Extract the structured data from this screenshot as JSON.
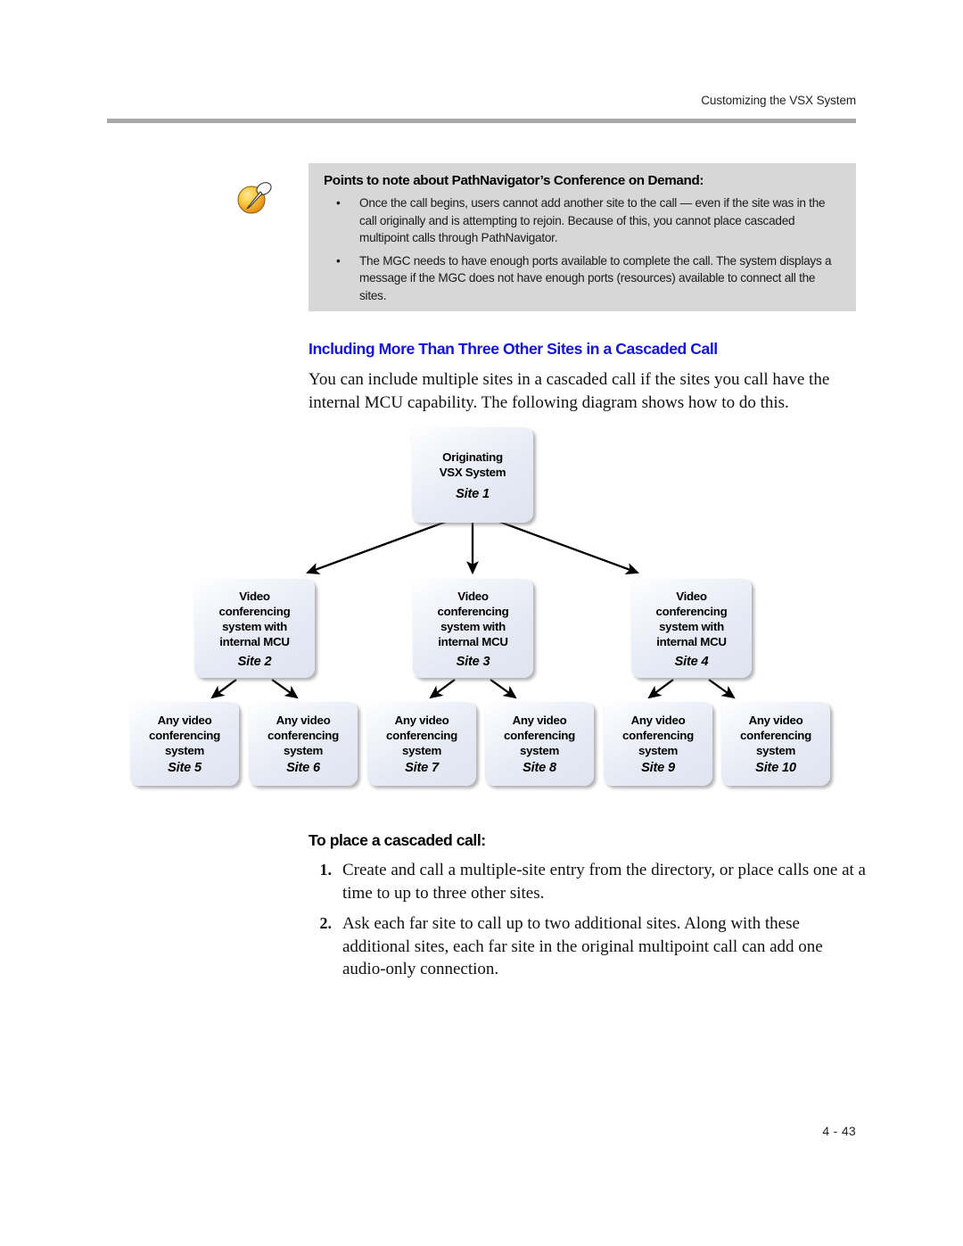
{
  "header": {
    "running_head": "Customizing the VSX System"
  },
  "note": {
    "icon": "note-pushpin-icon",
    "title": "Points to note about PathNavigator’s Conference on Demand:",
    "bullet_marker": "•",
    "bullets": [
      "Once the call begins, users cannot add another site to the call — even if the site was in the call originally and is attempting to rejoin. Because of this, you cannot place cascaded multipoint calls through PathNavigator.",
      "The MGC needs to have enough ports available to complete the call. The system displays a message if the MGC does not have enough ports (resources) available to connect all the sites."
    ]
  },
  "section": {
    "heading": "Including More Than Three Other Sites in a Cascaded Call",
    "heading_color": "#1414d2",
    "intro": "You can include multiple sites in a cascaded call if the sites you call have the internal MCU capability. The following diagram shows how to do this."
  },
  "diagram": {
    "nodes": {
      "site1": {
        "desc_lines": [
          "Originating",
          "VSX System"
        ],
        "site": "Site 1"
      },
      "site2": {
        "desc_lines": [
          "Video",
          "conferencing",
          "system with",
          "internal MCU"
        ],
        "site": "Site 2"
      },
      "site3": {
        "desc_lines": [
          "Video",
          "conferencing",
          "system with",
          "internal MCU"
        ],
        "site": "Site 3"
      },
      "site4": {
        "desc_lines": [
          "Video",
          "conferencing",
          "system with",
          "internal MCU"
        ],
        "site": "Site 4"
      },
      "site5": {
        "desc_lines": [
          "Any video",
          "conferencing",
          "system"
        ],
        "site": "Site 5"
      },
      "site6": {
        "desc_lines": [
          "Any video",
          "conferencing",
          "system"
        ],
        "site": "Site 6"
      },
      "site7": {
        "desc_lines": [
          "Any video",
          "conferencing",
          "system"
        ],
        "site": "Site 7"
      },
      "site8": {
        "desc_lines": [
          "Any video",
          "conferencing",
          "system"
        ],
        "site": "Site 8"
      },
      "site9": {
        "desc_lines": [
          "Any video",
          "conferencing",
          "system"
        ],
        "site": "Site 9"
      },
      "site10": {
        "desc_lines": [
          "Any video",
          "conferencing",
          "system"
        ],
        "site": "Site 10"
      }
    }
  },
  "procedure": {
    "heading": "To place a cascaded call:",
    "steps": [
      {
        "number": "1.",
        "text": "Create and call a multiple-site entry from the directory, or place calls one at a time to up to three other sites."
      },
      {
        "number": "2.",
        "text": "Ask each far site to call up to two additional sites. Along with these additional sites, each far site in the original multipoint call can add one audio-only connection."
      }
    ]
  },
  "footer": {
    "page_number": "4 - 43"
  }
}
